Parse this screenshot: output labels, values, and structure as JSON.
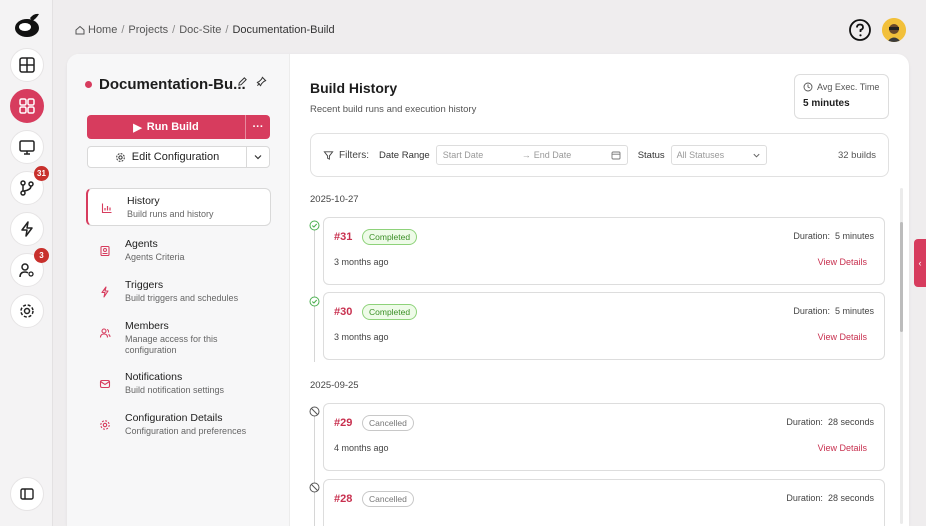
{
  "breadcrumb": {
    "items": [
      "Home",
      "Projects",
      "Doc-Site",
      "Documentation-Build"
    ]
  },
  "rail": {
    "items": [
      {
        "icon": "layout-icon"
      },
      {
        "icon": "dashboard-icon",
        "active": true
      },
      {
        "icon": "monitor-icon"
      },
      {
        "icon": "branch-icon",
        "badge": "31"
      },
      {
        "icon": "bolt-icon"
      },
      {
        "icon": "user-settings-icon",
        "badge": "3"
      },
      {
        "icon": "gear-icon"
      },
      {
        "icon": "panel-toggle-icon"
      }
    ]
  },
  "project": {
    "name": "Documentation-Bu...",
    "run_label": "Run Build",
    "more_label": "···",
    "config_label": "Edit Configuration"
  },
  "nav": [
    {
      "label": "History",
      "sub": "Build runs and history",
      "icon": "chart-icon",
      "active": true
    },
    {
      "label": "Agents",
      "sub": "Agents Criteria",
      "icon": "agent-icon"
    },
    {
      "label": "Triggers",
      "sub": "Build triggers and schedules",
      "icon": "bolt-icon"
    },
    {
      "label": "Members",
      "sub": "Manage access for this configuration",
      "icon": "members-icon"
    },
    {
      "label": "Notifications",
      "sub": "Build notification settings",
      "icon": "mail-icon"
    },
    {
      "label": "Configuration Details",
      "sub": "Configuration and preferences",
      "icon": "gear-icon"
    }
  ],
  "header": {
    "title": "Build History",
    "subtitle": "Recent build runs and execution history",
    "avg_label": "Avg Exec. Time",
    "avg_value": "5 minutes"
  },
  "filters": {
    "label": "Filters:",
    "date_range_label": "Date Range",
    "start_placeholder": "Start Date",
    "end_placeholder": "End Date",
    "status_label": "Status",
    "status_value": "All Statuses",
    "count": "32 builds"
  },
  "groups": [
    {
      "date": "2025-10-27",
      "runs": [
        {
          "id": "#31",
          "status": "Completed",
          "duration_label": "Duration:",
          "duration": "5 minutes",
          "ago": "3 months ago",
          "view": "View Details"
        },
        {
          "id": "#30",
          "status": "Completed",
          "duration_label": "Duration:",
          "duration": "5 minutes",
          "ago": "3 months ago",
          "view": "View Details"
        }
      ]
    },
    {
      "date": "2025-09-25",
      "runs": [
        {
          "id": "#29",
          "status": "Cancelled",
          "duration_label": "Duration:",
          "duration": "28 seconds",
          "ago": "4 months ago",
          "view": "View Details"
        },
        {
          "id": "#28",
          "status": "Cancelled",
          "duration_label": "Duration:",
          "duration": "28 seconds",
          "ago": "",
          "view": ""
        }
      ]
    }
  ],
  "colors": {
    "accent": "#d73c5e",
    "completed": "#3b8f26",
    "cancelled": "#777777"
  }
}
